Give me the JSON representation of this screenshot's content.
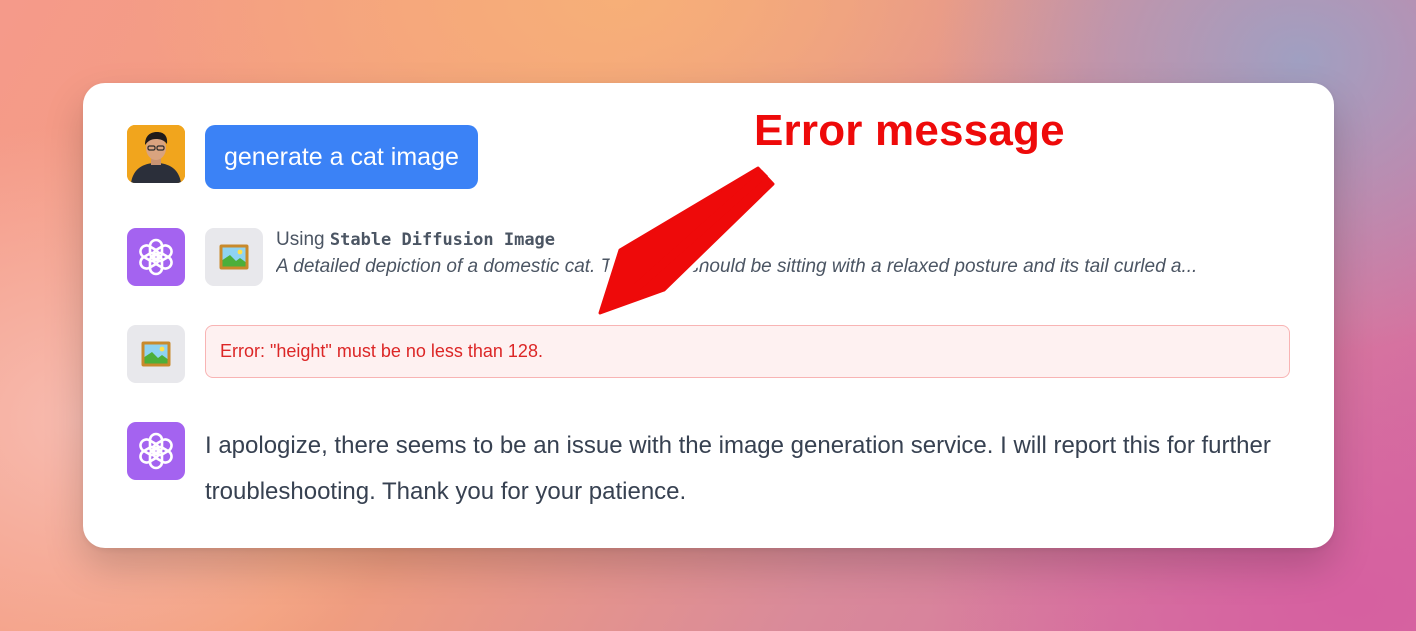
{
  "chat": {
    "user_message": "generate a cat image",
    "tool": {
      "using_prefix": "Using",
      "tool_name": "Stable Diffusion Image",
      "prompt": "A detailed depiction of a domestic cat. The feline should be sitting with a relaxed posture and its tail curled a..."
    },
    "error_text": "Error: \"height\" must be no less than 128.",
    "assistant_reply": "I apologize, there seems to be an issue with the image generation service. I will report this for further troubleshooting. Thank you for your patience."
  },
  "annotation": {
    "label": "Error message",
    "color": "#ee0a0a"
  },
  "colors": {
    "user_bubble": "#3b82f6",
    "assistant_avatar": "#a463f0",
    "error_text": "#dc2626",
    "error_bg": "#fef1f1"
  },
  "icons": {
    "user_avatar": "user-photo-avatar",
    "assistant_avatar": "openai-logo-icon",
    "tool_icon": "framed-picture-icon"
  }
}
